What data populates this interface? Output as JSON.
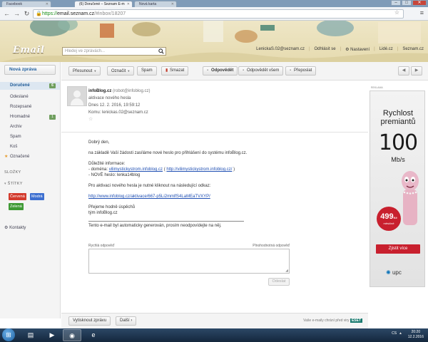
{
  "browser": {
    "tabs": [
      {
        "label": "Facebook"
      },
      {
        "label": "(6) Doručené – Seznam E-m"
      },
      {
        "label": "Nová karta"
      }
    ],
    "url_scheme": "https://",
    "url_host": "email.seznam.cz",
    "url_path": "/#inbox/18207"
  },
  "header": {
    "logo": "Email",
    "search_placeholder": "Hledej ve zprávách...",
    "user_email": "LenickaS.02@seznam.cz",
    "links": [
      "Odhlásit se",
      "Nastavení",
      "Lidé.cz",
      "Seznam.cz"
    ]
  },
  "sidebar": {
    "compose": "Nová zpráva",
    "folders": [
      {
        "label": "Doručené",
        "count": "6"
      },
      {
        "label": "Odeslané"
      },
      {
        "label": "Rozepsané"
      },
      {
        "label": "Hromadné",
        "count": "1"
      },
      {
        "label": "Archiv"
      },
      {
        "label": "Spam"
      },
      {
        "label": "Koš"
      },
      {
        "label": "Označené"
      }
    ],
    "folders_section": "SLOŽKY",
    "tags_section": "ŠTÍTKY",
    "tags": [
      {
        "label": "Červená",
        "color": "#d33a2c"
      },
      {
        "label": "Modrá",
        "color": "#3d6fd0"
      },
      {
        "label": "Zelená",
        "color": "#3f9a35"
      }
    ],
    "contacts": "Kontakty"
  },
  "toolbar": {
    "move": "Přesunout",
    "mark": "Označit",
    "spam": "Spam",
    "delete": "Smazat",
    "reply": "Odpovědět",
    "reply_all": "Odpovědět všem",
    "forward": "Přeposlat"
  },
  "message": {
    "from_name": "infoBlog.cz",
    "from_addr": "(robot@infoblog.cz)",
    "subject": "aktivace nového hesla",
    "date": "Dnes 12. 2. 2016, 19:59:12",
    "to": "Komu: lenickas.02@seznam.cz",
    "greeting": "Dobrý den,",
    "intro": "na základě Vaší žádosti zasíláme nové heslo pro přihlášení do systému infoBlog.cz.",
    "info_title": "Důležité informace:",
    "domain_prefix": "- doména: ",
    "domain_link1": "vilimystickystrom.infoblog.cz",
    "domain_mid": " ( ",
    "domain_link2": "http://vilimystickystrom.infoblog.cz/",
    "domain_suffix": " )",
    "new_password": "- NOVÉ heslo: lenka14blog",
    "activation_text": "Pro aktivaci nového hesla je nutné kliknout na následující odkaz:",
    "activation_link": "http://www.infoblog.cz/aktivace/667-p5Li2mmlfS4LaMEaTVXYP/",
    "wish": "Přejeme hodně úspěchů",
    "team": "tým infoBlog.cz",
    "auto_note": "Tento e-mail byl automaticky generován, prosím neodpovídejte na něj.",
    "quick_reply": "Rychlá odpověď",
    "full_reply": "Plnohodnotná odpověď",
    "send": "Odeslat"
  },
  "ad": {
    "label": "REKLAMA",
    "title_line1": "Rychlost",
    "title_line2": "premiantů",
    "speed": "100",
    "unit": "Mb/s",
    "price": "499",
    "price_currency": "Kč",
    "price_period": "měsíčně",
    "cta": "Zjistit více",
    "brand": "upc"
  },
  "bottom": {
    "print": "Vytisknout zprávu",
    "next": "Další",
    "eset_text": "Vaše e-maily chrání před viry",
    "eset": "ESET"
  },
  "taskbar": {
    "lang": "CS",
    "time": "20:20",
    "date": "12.2.2016"
  }
}
